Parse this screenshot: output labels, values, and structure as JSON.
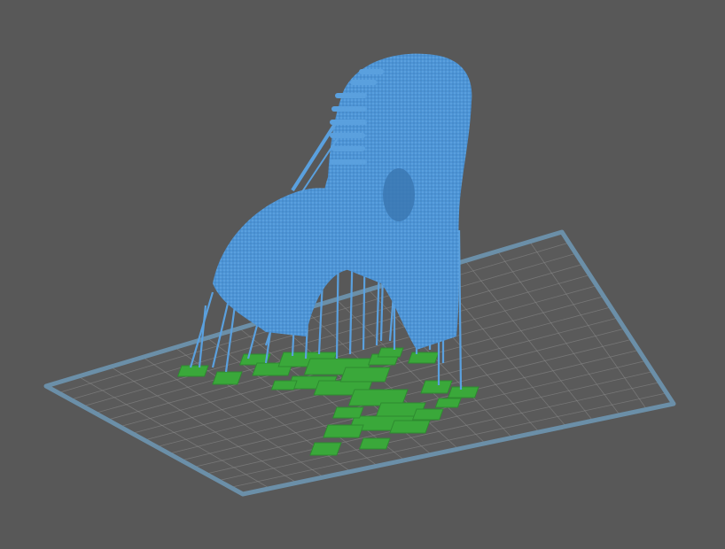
{
  "viewport": {
    "background": "#585858",
    "view_mode": "3d-perspective"
  },
  "build_plate": {
    "border_color": "#6b8fa8",
    "grid_color": "#8a8a8a",
    "surface_color": "#5a5a5a",
    "grid_divisions": 16
  },
  "model": {
    "kind": "skull-with-supports",
    "color": "#4d94d6",
    "highlight_color": "#6aaee6",
    "shadow_color": "#3a76b0"
  },
  "supports": {
    "color": "#5aa0de",
    "base_pad_color": "#3aa83a",
    "base_pad_dark": "#2e8a30"
  }
}
